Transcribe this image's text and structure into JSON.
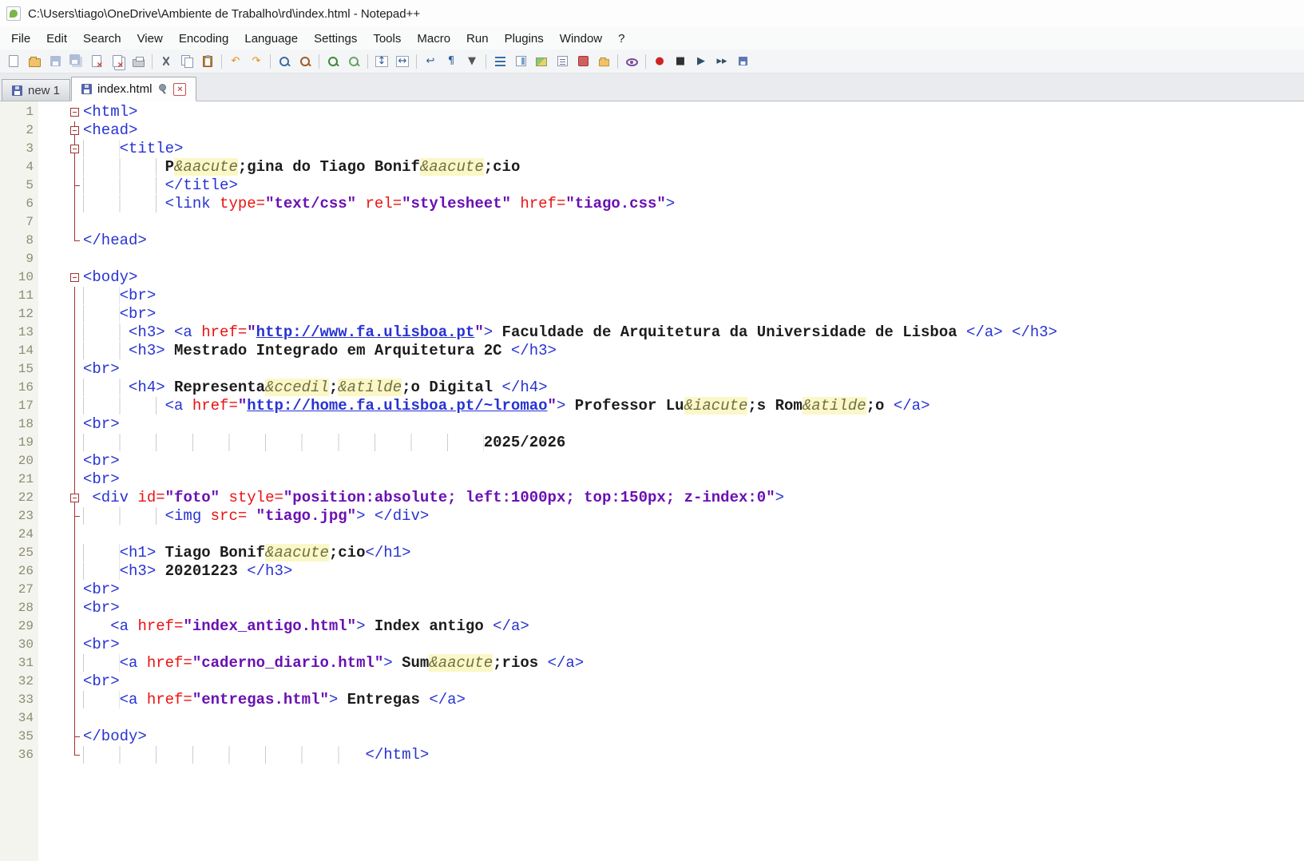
{
  "window": {
    "title": "C:\\Users\\tiago\\OneDrive\\Ambiente de Trabalho\\rd\\index.html - Notepad++"
  },
  "menu": [
    "File",
    "Edit",
    "Search",
    "View",
    "Encoding",
    "Language",
    "Settings",
    "Tools",
    "Macro",
    "Run",
    "Plugins",
    "Window",
    "?"
  ],
  "toolbar": {
    "items": [
      {
        "name": "new-file",
        "kind": "pg"
      },
      {
        "name": "open-file",
        "kind": "fld"
      },
      {
        "name": "save",
        "kind": "flp dim"
      },
      {
        "name": "save-all",
        "kind": "flp2 dim"
      },
      {
        "name": "close-file",
        "kind": "pg px"
      },
      {
        "name": "close-all",
        "kind": "pg px all"
      },
      {
        "name": "print",
        "kind": "prn"
      },
      "|",
      {
        "name": "cut",
        "kind": "cutic"
      },
      {
        "name": "copy",
        "kind": "cpy"
      },
      {
        "name": "paste",
        "kind": "pst"
      },
      "|",
      {
        "name": "undo",
        "glyph": "↶",
        "color": "#e2901c"
      },
      {
        "name": "redo",
        "glyph": "↷",
        "color": "#e2901c"
      },
      "|",
      {
        "name": "find",
        "kind": "mag"
      },
      {
        "name": "replace",
        "kind": "mag rp"
      },
      "|",
      {
        "name": "zoom-in",
        "kind": "mag zi"
      },
      {
        "name": "zoom-out",
        "kind": "mag zo"
      },
      "|",
      {
        "name": "sync-vertical-scroll",
        "kind": "bxg",
        "glyph": "↕",
        "color": "#2a5a9a"
      },
      {
        "name": "sync-horizontal-scroll",
        "kind": "bxg",
        "glyph": "↔",
        "color": "#2a5a9a"
      },
      "|",
      {
        "name": "word-wrap",
        "glyph": "↩",
        "color": "#2a5a9a"
      },
      {
        "name": "show-all-characters",
        "glyph": "¶",
        "color": "#2a5a9a"
      },
      {
        "name": "toolbar-dropdown",
        "kind": "sm",
        "glyph": "▼",
        "color": "#555555"
      },
      "|",
      {
        "name": "function-list",
        "kind": "fnl"
      },
      {
        "name": "document-map",
        "kind": "dmap"
      },
      {
        "name": "document-snapshot",
        "kind": "snap"
      },
      {
        "name": "document-list",
        "kind": "dlst"
      },
      {
        "name": "plugin-icon",
        "kind": "plg"
      },
      {
        "name": "folder-as-workspace",
        "kind": "fld sm2"
      },
      "|",
      {
        "name": "file-monitoring",
        "kind": "eye"
      },
      "|",
      {
        "name": "macro-record",
        "glyph": "●",
        "color": "#cc2424"
      },
      {
        "name": "macro-stop",
        "glyph": "■",
        "color": "#303030"
      },
      {
        "name": "macro-playback",
        "glyph": "▶",
        "color": "#2f4f66"
      },
      {
        "name": "macro-run-multiple",
        "glyph": "▸▸",
        "color": "#2f4f66"
      },
      {
        "name": "macro-save",
        "kind": "flp sm2"
      }
    ]
  },
  "tabs": [
    {
      "label": "new 1"
    },
    {
      "label": "index.html",
      "close_glyph": "×"
    }
  ],
  "palette": {
    "tag": "#2733d2",
    "attr": "#eb1212",
    "val": "#6a10b2",
    "url": "#2733d2",
    "text": "#1c1c1c",
    "entfg": "#6f6f46",
    "entbg": "#fbf7c6",
    "fold": "#a43333",
    "lnum": "#8c8c74",
    "guide": "#cccccc"
  },
  "editor": {
    "lines": [
      {
        "n": 1,
        "f": "box",
        "s": [
          [
            "t",
            "<html>"
          ]
        ]
      },
      {
        "n": 2,
        "f": "v box",
        "s": [
          [
            "t",
            "<head>"
          ]
        ]
      },
      {
        "n": 3,
        "f": "v box",
        "s": [
          [
            "p",
            "    "
          ],
          [
            "t",
            "<title>"
          ]
        ]
      },
      {
        "n": 4,
        "f": "v",
        "s": [
          [
            "p",
            "         "
          ],
          [
            "p",
            "P"
          ],
          [
            "e",
            "&aacute"
          ],
          [
            "p",
            ";gina do Tiago Bonif"
          ],
          [
            "e",
            "&aacute"
          ],
          [
            "p",
            ";cio"
          ]
        ]
      },
      {
        "n": 5,
        "f": "e",
        "s": [
          [
            "p",
            "         "
          ],
          [
            "t",
            "</title>"
          ]
        ]
      },
      {
        "n": 6,
        "f": "v",
        "s": [
          [
            "p",
            "         "
          ],
          [
            "t",
            "<link "
          ],
          [
            "a",
            "type="
          ],
          [
            "v",
            "\"text/css\""
          ],
          [
            "p",
            " "
          ],
          [
            "a",
            "rel="
          ],
          [
            "v",
            "\"stylesheet\""
          ],
          [
            "p",
            " "
          ],
          [
            "a",
            "href="
          ],
          [
            "v",
            "\"tiago.css\""
          ],
          [
            "t",
            ">"
          ]
        ]
      },
      {
        "n": 7,
        "f": "v",
        "s": []
      },
      {
        "n": 8,
        "f": "E",
        "s": [
          [
            "t",
            "</head>"
          ]
        ]
      },
      {
        "n": 9,
        "s": []
      },
      {
        "n": 10,
        "f": "box",
        "s": [
          [
            "t",
            "<body>"
          ]
        ]
      },
      {
        "n": 11,
        "f": "v",
        "s": [
          [
            "p",
            "    "
          ],
          [
            "t",
            "<br>"
          ]
        ]
      },
      {
        "n": 12,
        "f": "v",
        "s": [
          [
            "p",
            "    "
          ],
          [
            "t",
            "<br>"
          ]
        ]
      },
      {
        "n": 13,
        "f": "v",
        "s": [
          [
            "p",
            "     "
          ],
          [
            "t",
            "<h3>"
          ],
          [
            "p",
            " "
          ],
          [
            "t",
            "<a "
          ],
          [
            "a",
            "href="
          ],
          [
            "v",
            "\""
          ],
          [
            "u",
            "http://www.fa.ulisboa.pt"
          ],
          [
            "v",
            "\""
          ],
          [
            "t",
            ">"
          ],
          [
            "p",
            " Faculdade de Arquitetura da Universidade de Lisboa "
          ],
          [
            "t",
            "</a>"
          ],
          [
            "p",
            " "
          ],
          [
            "t",
            "</h3>"
          ]
        ]
      },
      {
        "n": 14,
        "f": "v",
        "s": [
          [
            "p",
            "     "
          ],
          [
            "t",
            "<h3>"
          ],
          [
            "p",
            " Mestrado Integrado em Arquitetura 2C "
          ],
          [
            "t",
            "</h3>"
          ]
        ]
      },
      {
        "n": 15,
        "f": "v",
        "s": [
          [
            "t",
            "<br>"
          ]
        ]
      },
      {
        "n": 16,
        "f": "v",
        "s": [
          [
            "p",
            "     "
          ],
          [
            "t",
            "<h4>"
          ],
          [
            "p",
            " Representa"
          ],
          [
            "e",
            "&ccedil"
          ],
          [
            "p",
            ";"
          ],
          [
            "e",
            "&atilde"
          ],
          [
            "p",
            ";o Digital "
          ],
          [
            "t",
            "</h4>"
          ]
        ]
      },
      {
        "n": 17,
        "f": "v",
        "s": [
          [
            "p",
            "         "
          ],
          [
            "t",
            "<a "
          ],
          [
            "a",
            "href="
          ],
          [
            "v",
            "\""
          ],
          [
            "u",
            "http://home.fa.ulisboa.pt/~lromao"
          ],
          [
            "v",
            "\""
          ],
          [
            "t",
            ">"
          ],
          [
            "p",
            " Professor Lu"
          ],
          [
            "e",
            "&iacute"
          ],
          [
            "p",
            ";s Rom"
          ],
          [
            "e",
            "&atilde"
          ],
          [
            "p",
            ";o "
          ],
          [
            "t",
            "</a>"
          ]
        ]
      },
      {
        "n": 18,
        "f": "v",
        "s": []
      },
      {
        "n": 19,
        "f": "v",
        "s": [
          [
            "w",
            44
          ],
          [
            "p",
            "2025/2026"
          ]
        ]
      },
      {
        "n": 20,
        "f": "v",
        "s": [
          [
            "t",
            "<br>"
          ]
        ]
      },
      {
        "n": 21,
        "f": "v",
        "s": [
          [
            "t",
            "<br>"
          ]
        ]
      },
      {
        "n": 22,
        "f": "v box",
        "s": [
          [
            "p",
            " "
          ],
          [
            "t",
            "<div "
          ],
          [
            "a",
            "id="
          ],
          [
            "v",
            "\"foto\""
          ],
          [
            "p",
            " "
          ],
          [
            "a",
            "style="
          ],
          [
            "v",
            "\"position:absolute; left:1000px; top:150px; z-index:0\""
          ],
          [
            "t",
            ">"
          ]
        ]
      },
      {
        "n": 23,
        "f": "e",
        "s": [
          [
            "p",
            "         "
          ],
          [
            "t",
            "<img "
          ],
          [
            "a",
            "src= "
          ],
          [
            "v",
            "\"tiago.jpg\""
          ],
          [
            "t",
            ">"
          ],
          [
            "p",
            " "
          ],
          [
            "t",
            "</div>"
          ]
        ]
      },
      {
        "n": 24,
        "f": "v",
        "s": []
      },
      {
        "n": 25,
        "f": "v",
        "s": [
          [
            "p",
            "    "
          ],
          [
            "t",
            "<h1>"
          ],
          [
            "p",
            " Tiago Bonif"
          ],
          [
            "e",
            "&aacute"
          ],
          [
            "p",
            ";cio"
          ],
          [
            "t",
            "</h1>"
          ]
        ]
      },
      {
        "n": 26,
        "f": "v",
        "s": [
          [
            "p",
            "    "
          ],
          [
            "t",
            "<h3>"
          ],
          [
            "p",
            " 20201223 "
          ],
          [
            "t",
            "</h3>"
          ]
        ]
      },
      {
        "n": 27,
        "f": "v",
        "s": [
          [
            "t",
            "<br>"
          ]
        ]
      },
      {
        "n": 28,
        "f": "v",
        "s": [
          [
            "t",
            "<br>"
          ]
        ]
      },
      {
        "n": 29,
        "f": "v",
        "s": [
          [
            "p",
            "   "
          ],
          [
            "t",
            "<a "
          ],
          [
            "a",
            "href="
          ],
          [
            "v",
            "\"index_antigo.html\""
          ],
          [
            "t",
            ">"
          ],
          [
            "p",
            " Index antigo "
          ],
          [
            "t",
            "</a>"
          ]
        ]
      },
      {
        "n": 30,
        "f": "v",
        "s": [
          [
            "t",
            "<br>"
          ]
        ]
      },
      {
        "n": 31,
        "f": "v",
        "s": [
          [
            "p",
            "    "
          ],
          [
            "t",
            "<a "
          ],
          [
            "a",
            "href="
          ],
          [
            "v",
            "\"caderno_diario.html\""
          ],
          [
            "t",
            ">"
          ],
          [
            "p",
            " Sum"
          ],
          [
            "e",
            "&aacute"
          ],
          [
            "p",
            ";rios "
          ],
          [
            "t",
            "</a>"
          ]
        ]
      },
      {
        "n": 32,
        "f": "v",
        "s": [
          [
            "t",
            "<br>"
          ]
        ]
      },
      {
        "n": 33,
        "f": "v",
        "s": [
          [
            "p",
            "    "
          ],
          [
            "t",
            "<a "
          ],
          [
            "a",
            "href="
          ],
          [
            "v",
            "\"entregas.html\""
          ],
          [
            "t",
            ">"
          ],
          [
            "p",
            " Entregas "
          ],
          [
            "t",
            "</a>"
          ]
        ]
      },
      {
        "n": 34,
        "f": "v",
        "s": []
      },
      {
        "n": 35,
        "f": "e",
        "s": [
          [
            "t",
            "</body>"
          ]
        ]
      },
      {
        "n": 36,
        "f": "E",
        "s": [
          [
            "w",
            31
          ],
          [
            "t",
            "</html>"
          ]
        ]
      }
    ]
  },
  "line_18_tag": "<br>"
}
